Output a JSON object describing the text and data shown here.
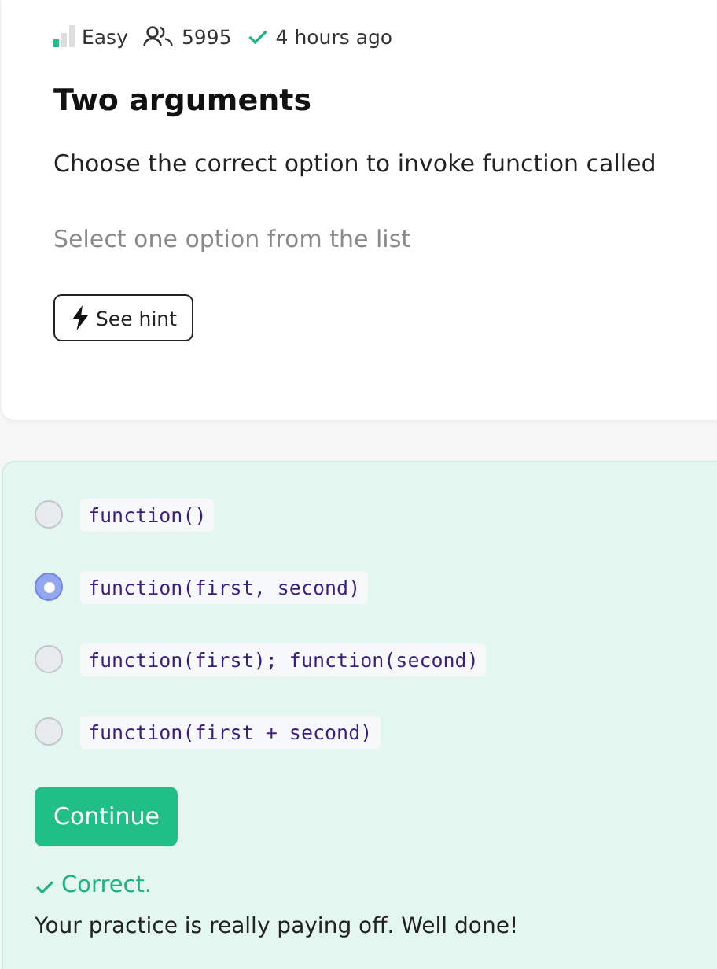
{
  "meta": {
    "difficulty": "Easy",
    "solvers": "5995",
    "solved_time": "4 hours ago"
  },
  "step": {
    "title": "Two arguments",
    "question": "Choose the correct option to invoke function called",
    "instruction": "Select one option from the list",
    "hint_button": "See hint"
  },
  "options": [
    {
      "label": "function()",
      "selected": false
    },
    {
      "label": "function(first, second)",
      "selected": true
    },
    {
      "label": "function(first); function(second)",
      "selected": false
    },
    {
      "label": "function(first + second)",
      "selected": false
    }
  ],
  "continue_button": "Continue",
  "feedback": {
    "status": "Correct.",
    "message": "Your practice is really paying off. Well done!"
  }
}
